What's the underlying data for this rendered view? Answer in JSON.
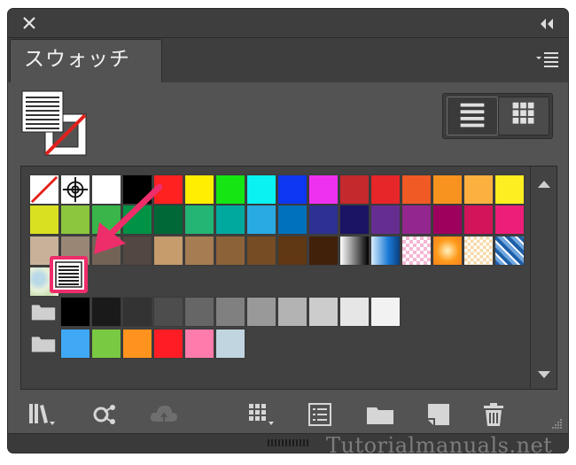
{
  "panel": {
    "tab_label": "スウォッチ"
  },
  "swatches": {
    "row1": [
      "#ffffff",
      "#ffffff",
      "#ffffff",
      "#000000",
      "#ff2020",
      "#ffee00",
      "#15e512",
      "#0af2f2",
      "#0d37f3",
      "#ee30f0",
      "#c42a2d",
      "#e7262a",
      "#f05a24",
      "#f7931e",
      "#fbb040",
      "#fcee21"
    ],
    "row2": [
      "#d9e021",
      "#8cc63f",
      "#39b54a",
      "#009245",
      "#006837",
      "#22b573",
      "#00a99d",
      "#29abe2",
      "#0071bc",
      "#2e3192",
      "#1b1464",
      "#662d91",
      "#93278f",
      "#9e005d",
      "#d4145a",
      "#ed1e79"
    ],
    "row3": [
      "#c7b299",
      "#998675",
      "#736357",
      "#534741",
      "#c69c6d",
      "#a67c52",
      "#8c6239",
      "#754c24",
      "#603813",
      "#42210b"
    ],
    "row5": [
      "#000000",
      "#1a1a1a",
      "#333333",
      "#4d4d4d",
      "#666666",
      "#808080",
      "#999999",
      "#b3b3b3",
      "#cccccc",
      "#e6e6e6",
      "#f2f2f2"
    ],
    "row6": [
      "#3fa9f5",
      "#7ac943",
      "#ff931e",
      "#ff1d25",
      "#ff7bac",
      "#c1d5e0"
    ]
  },
  "watermark": "Tutorialmanuals.net",
  "colors": {
    "panel_bg": "#535353",
    "highlight": "#ee2d6b"
  }
}
